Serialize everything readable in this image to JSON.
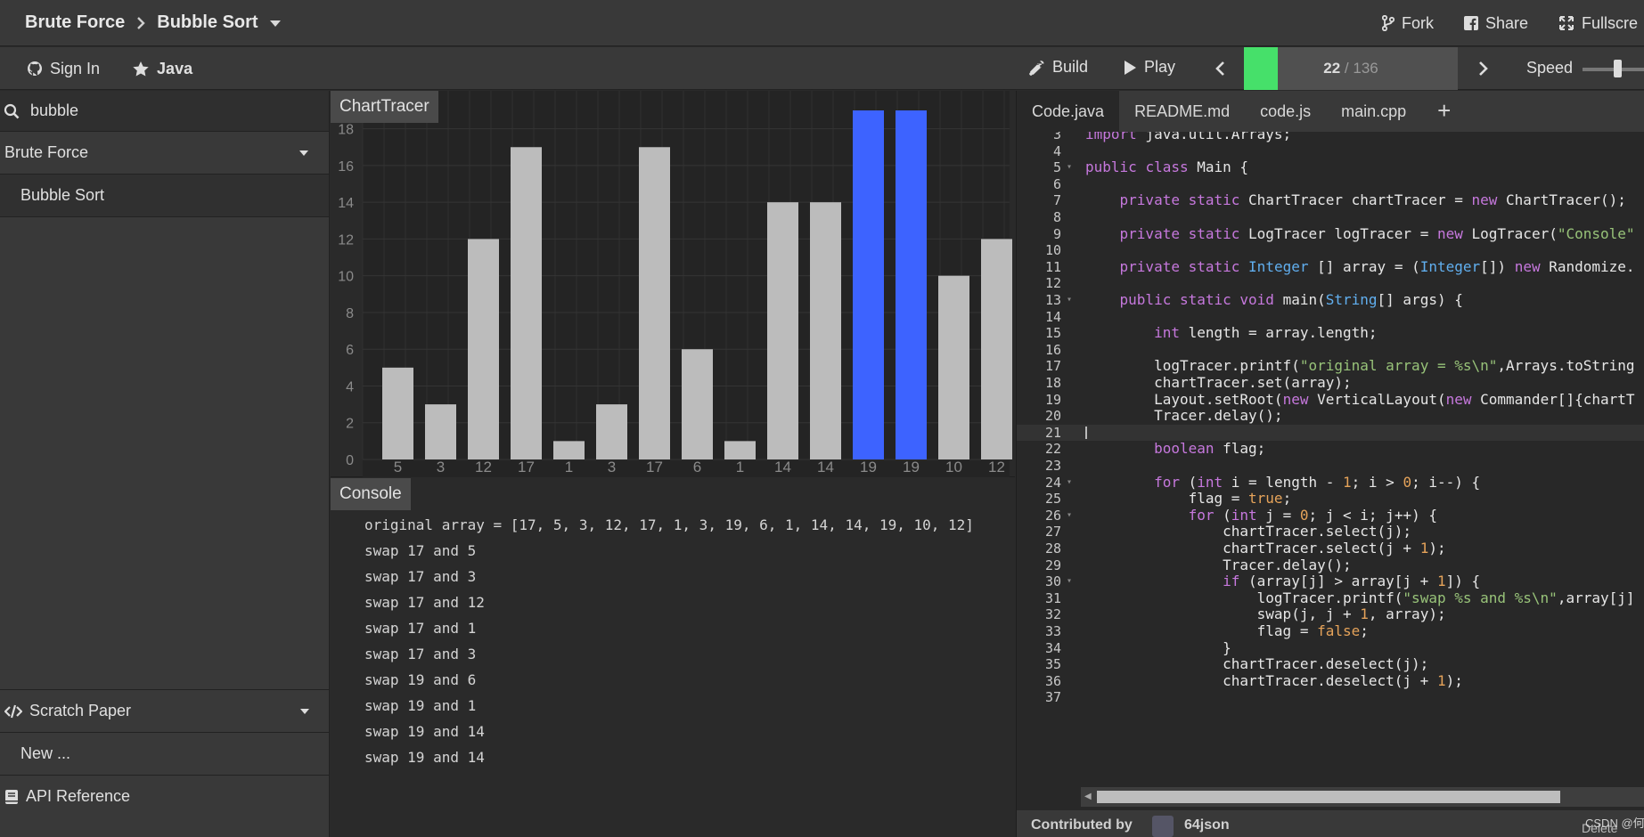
{
  "header": {
    "breadcrumb": [
      "Brute Force",
      "Bubble Sort"
    ],
    "fork_label": "Fork",
    "share_label": "Share",
    "fullscreen_label": "Fullscre"
  },
  "toolbar": {
    "signin_label": "Sign In",
    "language_label": "Java",
    "build_label": "Build",
    "play_label": "Play",
    "progress_current": "22",
    "progress_total": "/ 136",
    "progress_fraction": 0.16,
    "speed_label": "Speed",
    "speed_level": 0.57
  },
  "sidebar": {
    "search_value": "bubble",
    "category_label": "Brute Force",
    "item_label": "Bubble Sort",
    "scratch_label": "Scratch Paper",
    "new_label": "New ...",
    "api_label": "API Reference"
  },
  "chart_panel": {
    "title": "ChartTracer"
  },
  "chart_data": {
    "type": "bar",
    "categories": [
      "5",
      "3",
      "12",
      "17",
      "1",
      "3",
      "17",
      "6",
      "1",
      "14",
      "14",
      "19",
      "19",
      "10",
      "12"
    ],
    "values": [
      5,
      3,
      12,
      17,
      1,
      3,
      17,
      6,
      1,
      14,
      14,
      19,
      19,
      10,
      12
    ],
    "highlighted_indices": [
      11,
      12
    ],
    "yticks": [
      0,
      2,
      4,
      6,
      8,
      10,
      12,
      14,
      16,
      18
    ],
    "ylim": [
      0,
      19
    ],
    "grid": true,
    "colors": {
      "bar": "#bcbcbc",
      "selected": "#3d63ff"
    }
  },
  "console_panel": {
    "title": "Console",
    "lines": [
      "original array = [17, 5, 3, 12, 17, 1, 3, 19, 6, 1, 14, 14, 19, 10, 12]",
      "swap 17 and 5",
      "swap 17 and 3",
      "swap 17 and 12",
      "swap 17 and 1",
      "swap 17 and 3",
      "swap 19 and 6",
      "swap 19 and 1",
      "swap 19 and 14",
      "swap 19 and 14"
    ]
  },
  "editor": {
    "tabs": [
      "Code.java",
      "README.md",
      "code.js",
      "main.cpp"
    ],
    "active_tab": 0,
    "add_tab_label": "+",
    "current_line": 21,
    "lines": [
      {
        "n": "3",
        "fold": false,
        "code": "import java.util.Arrays;"
      },
      {
        "n": "4",
        "fold": false,
        "code": ""
      },
      {
        "n": "5",
        "fold": true,
        "code": "public class Main {"
      },
      {
        "n": "6",
        "fold": false,
        "code": ""
      },
      {
        "n": "7",
        "fold": false,
        "code": "    private static ChartTracer chartTracer = new ChartTracer();"
      },
      {
        "n": "8",
        "fold": false,
        "code": ""
      },
      {
        "n": "9",
        "fold": false,
        "code": "    private static LogTracer logTracer = new LogTracer(\"Console\""
      },
      {
        "n": "10",
        "fold": false,
        "code": ""
      },
      {
        "n": "11",
        "fold": false,
        "code": "    private static Integer [] array = (Integer[]) new Randomize."
      },
      {
        "n": "12",
        "fold": false,
        "code": ""
      },
      {
        "n": "13",
        "fold": true,
        "code": "    public static void main(String[] args) {"
      },
      {
        "n": "14",
        "fold": false,
        "code": ""
      },
      {
        "n": "15",
        "fold": false,
        "code": "        int length = array.length;"
      },
      {
        "n": "16",
        "fold": false,
        "code": ""
      },
      {
        "n": "17",
        "fold": false,
        "code": "        logTracer.printf(\"original array = %s\\n\",Arrays.toString"
      },
      {
        "n": "18",
        "fold": false,
        "code": "        chartTracer.set(array);"
      },
      {
        "n": "19",
        "fold": false,
        "code": "        Layout.setRoot(new VerticalLayout(new Commander[]{chartT"
      },
      {
        "n": "20",
        "fold": false,
        "code": "        Tracer.delay();"
      },
      {
        "n": "21",
        "fold": false,
        "code": ""
      },
      {
        "n": "22",
        "fold": false,
        "code": "        boolean flag;"
      },
      {
        "n": "23",
        "fold": false,
        "code": ""
      },
      {
        "n": "24",
        "fold": true,
        "code": "        for (int i = length - 1; i > 0; i--) {"
      },
      {
        "n": "25",
        "fold": false,
        "code": "            flag = true;"
      },
      {
        "n": "26",
        "fold": true,
        "code": "            for (int j = 0; j < i; j++) {"
      },
      {
        "n": "27",
        "fold": false,
        "code": "                chartTracer.select(j);"
      },
      {
        "n": "28",
        "fold": false,
        "code": "                chartTracer.select(j + 1);"
      },
      {
        "n": "29",
        "fold": false,
        "code": "                Tracer.delay();"
      },
      {
        "n": "30",
        "fold": true,
        "code": "                if (array[j] > array[j + 1]) {"
      },
      {
        "n": "31",
        "fold": false,
        "code": "                    logTracer.printf(\"swap %s and %s\\n\",array[j]"
      },
      {
        "n": "32",
        "fold": false,
        "code": "                    swap(j, j + 1, array);"
      },
      {
        "n": "33",
        "fold": false,
        "code": "                    flag = false;"
      },
      {
        "n": "34",
        "fold": false,
        "code": "                }"
      },
      {
        "n": "35",
        "fold": false,
        "code": "                chartTracer.deselect(j);"
      },
      {
        "n": "36",
        "fold": false,
        "code": "                chartTracer.deselect(j + 1);"
      },
      {
        "n": "37",
        "fold": false,
        "code": ""
      }
    ]
  },
  "footer": {
    "contributed_label": "Contributed by",
    "user_label": "64json",
    "delete_label": "Delete"
  },
  "watermark": "CSDN @何怀逸"
}
